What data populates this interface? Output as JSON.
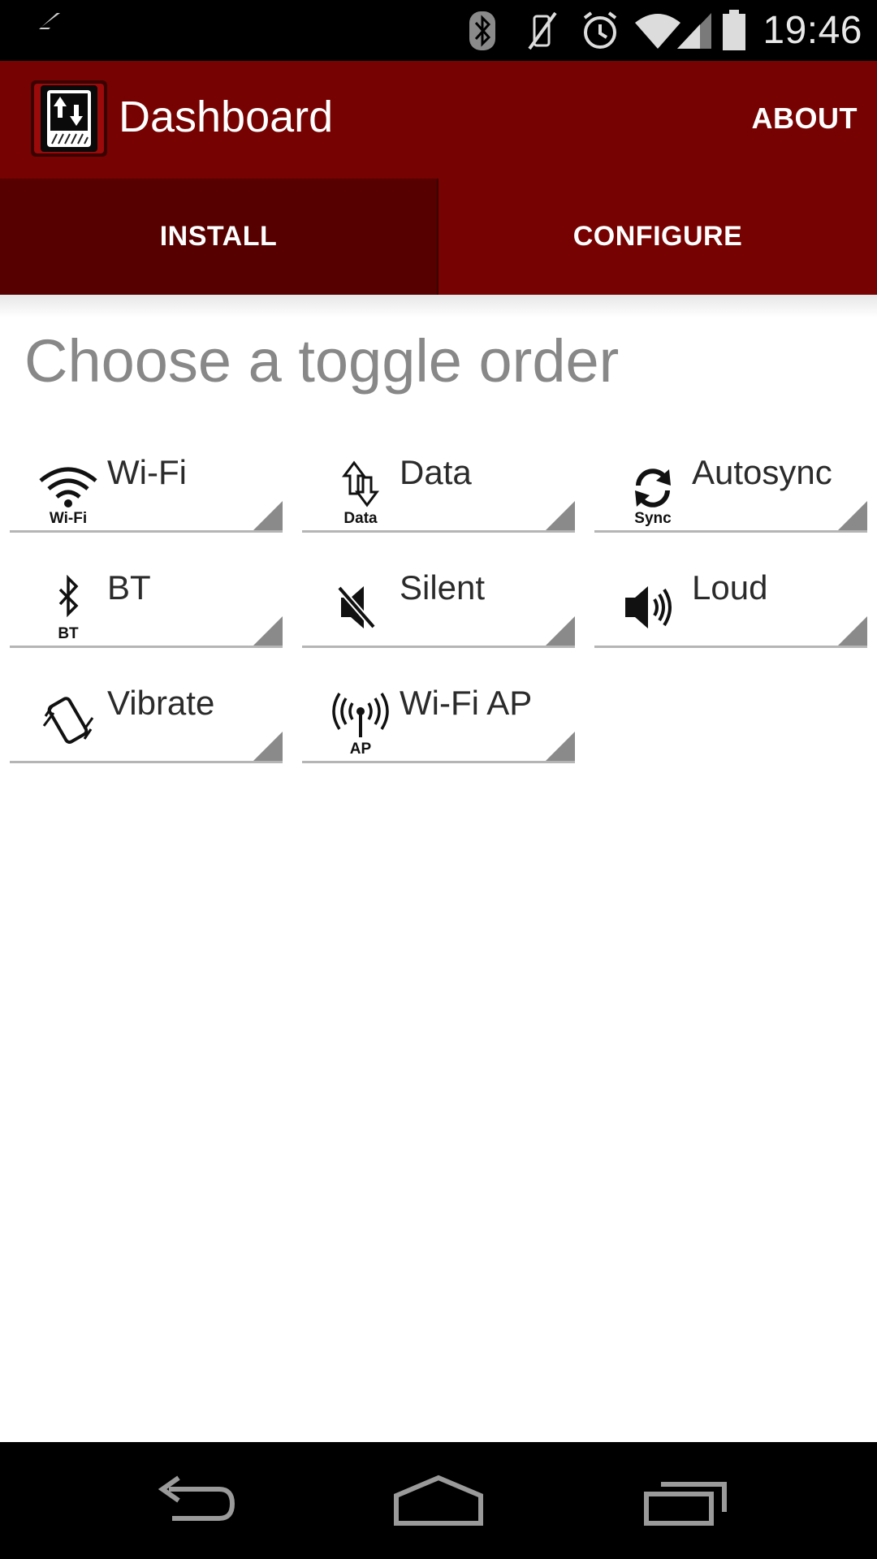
{
  "status_bar": {
    "time": "19:46",
    "icons": [
      "flash-icon",
      "bluetooth-icon",
      "vibrate-off-icon",
      "alarm-icon",
      "wifi-signal-icon",
      "cell-signal-icon",
      "battery-icon"
    ]
  },
  "action_bar": {
    "title": "Dashboard",
    "about_label": "ABOUT",
    "logo_icon": "sync-arrows-logo-icon"
  },
  "tabs": [
    {
      "label": "INSTALL",
      "selected": true
    },
    {
      "label": "CONFIGURE",
      "selected": false
    }
  ],
  "heading": "Choose a toggle order",
  "toggles": [
    {
      "label": "Wi-Fi",
      "icon": "wifi-icon",
      "icon_caption": "Wi-Fi"
    },
    {
      "label": "Data",
      "icon": "data-icon",
      "icon_caption": "Data"
    },
    {
      "label": "Autosync",
      "icon": "sync-icon",
      "icon_caption": "Sync"
    },
    {
      "label": "BT",
      "icon": "bluetooth-icon",
      "icon_caption": "BT"
    },
    {
      "label": "Silent",
      "icon": "silent-icon",
      "icon_caption": ""
    },
    {
      "label": "Loud",
      "icon": "loud-icon",
      "icon_caption": ""
    },
    {
      "label": "Vibrate",
      "icon": "vibrate-icon",
      "icon_caption": ""
    },
    {
      "label": "Wi-Fi AP",
      "icon": "hotspot-icon",
      "icon_caption": "AP"
    }
  ],
  "nav_bar": {
    "icons": [
      "back-icon",
      "home-icon",
      "recents-icon"
    ]
  },
  "colors": {
    "action_bar": "#770202",
    "selected_tab": "#560000",
    "heading": "#888888"
  }
}
